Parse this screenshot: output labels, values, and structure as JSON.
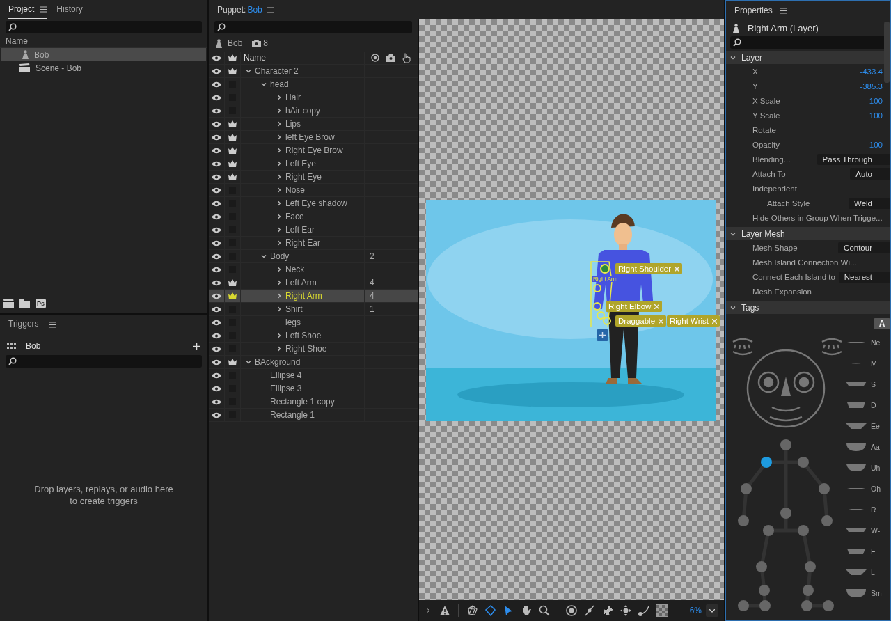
{
  "project_panel": {
    "tabs": [
      {
        "label": "Project",
        "selected": true
      },
      {
        "label": "History",
        "selected": false
      }
    ],
    "column": "Name",
    "items": [
      {
        "kind": "puppet",
        "name": "Bob",
        "selected": true
      },
      {
        "kind": "scene",
        "name": "Scene - Bob",
        "selected": false
      }
    ],
    "footer_badge": "Ps"
  },
  "triggers_panel": {
    "title": "Triggers",
    "puppet": "Bob",
    "empty_message": "Drop layers, replays, or audio here to create triggers"
  },
  "puppet_panel": {
    "title": "Puppet:",
    "puppet_name": "Bob",
    "summary_name": "Bob",
    "behavior_count": "8",
    "column": "Name",
    "layers": [
      {
        "name": "Character 2",
        "crown": true,
        "expanded": true,
        "selected": false,
        "children": [
          {
            "name": "head",
            "crown": false,
            "expanded": true,
            "selected": false,
            "children": [
              {
                "name": "Hair",
                "crown": false,
                "expanded": false,
                "selected": false
              },
              {
                "name": "hAir copy",
                "crown": false,
                "expanded": false,
                "selected": false
              },
              {
                "name": "Lips",
                "crown": true,
                "expanded": false,
                "selected": false
              },
              {
                "name": "left Eye Brow",
                "crown": true,
                "expanded": false,
                "selected": false
              },
              {
                "name": "Right Eye Brow",
                "crown": true,
                "expanded": false,
                "selected": false
              },
              {
                "name": "Left Eye",
                "crown": true,
                "expanded": false,
                "selected": false
              },
              {
                "name": "Right Eye",
                "crown": true,
                "expanded": false,
                "selected": false
              },
              {
                "name": "Nose",
                "crown": false,
                "expanded": false,
                "selected": false
              },
              {
                "name": "Left Eye shadow",
                "crown": false,
                "expanded": false,
                "selected": false
              },
              {
                "name": "Face",
                "crown": false,
                "expanded": false,
                "selected": false
              },
              {
                "name": "Left Ear",
                "crown": false,
                "expanded": false,
                "selected": false
              },
              {
                "name": "Right Ear",
                "crown": false,
                "expanded": false,
                "selected": false
              }
            ]
          },
          {
            "name": "Body",
            "crown": false,
            "expanded": true,
            "selected": false,
            "count": "2",
            "children": [
              {
                "name": "Neck",
                "crown": false,
                "expanded": false,
                "selected": false
              },
              {
                "name": "Left Arm",
                "crown": true,
                "expanded": false,
                "selected": false,
                "count": "4"
              },
              {
                "name": "Right Arm",
                "crown": true,
                "expanded": false,
                "selected": true,
                "count": "4"
              },
              {
                "name": "Shirt",
                "crown": false,
                "expanded": false,
                "selected": false,
                "count": "1"
              },
              {
                "name": "legs",
                "crown": false,
                "selected": false
              },
              {
                "name": "Left Shoe",
                "crown": false,
                "expanded": false,
                "selected": false
              },
              {
                "name": "Right Shoe",
                "crown": false,
                "expanded": false,
                "selected": false
              }
            ]
          }
        ]
      },
      {
        "name": "BAckground",
        "crown": true,
        "expanded": true,
        "selected": false,
        "children": [
          {
            "name": "Ellipse 4",
            "crown": false,
            "selected": false
          },
          {
            "name": "Ellipse 3",
            "crown": false,
            "selected": false
          },
          {
            "name": "Rectangle 1 copy",
            "crown": false,
            "selected": false
          },
          {
            "name": "Rectangle 1",
            "crown": false,
            "selected": false
          }
        ]
      }
    ]
  },
  "canvas": {
    "arm_label": "Right Arm",
    "handles": [
      {
        "label": "Right Shoulder"
      },
      {
        "label": "Right Elbow"
      },
      {
        "label": "Draggable"
      },
      {
        "label": "Right Wrist"
      }
    ],
    "tool_groups": [
      [
        {
          "kind": "expand",
          "selected": false
        },
        {
          "kind": "warning",
          "selected": false
        }
      ],
      [
        {
          "kind": "mesh",
          "selected": false
        },
        {
          "kind": "outline",
          "selected": true
        },
        {
          "kind": "select",
          "selected": true
        },
        {
          "kind": "hand",
          "selected": false
        },
        {
          "kind": "zoom",
          "selected": false
        }
      ],
      [
        {
          "kind": "dragger",
          "selected": false
        },
        {
          "kind": "stick",
          "selected": false
        },
        {
          "kind": "pin",
          "selected": false
        },
        {
          "kind": "move",
          "selected": false
        },
        {
          "kind": "bend",
          "selected": false
        },
        {
          "kind": "checker",
          "selected": false
        }
      ]
    ],
    "zoom": "6%"
  },
  "properties_panel": {
    "title": "Properties",
    "layer_title": "Right Arm (Layer)",
    "sections": [
      {
        "title": "Layer",
        "expanded": true,
        "rows": [
          {
            "kind": "number",
            "label": "X",
            "value": "-433.4"
          },
          {
            "kind": "number",
            "label": "Y",
            "value": "-385.3"
          },
          {
            "kind": "number",
            "label": "X Scale",
            "value": "100"
          },
          {
            "kind": "number",
            "label": "Y Scale",
            "value": "100"
          },
          {
            "kind": "label",
            "label": "Rotate"
          },
          {
            "kind": "number",
            "label": "Opacity",
            "value": "100"
          },
          {
            "kind": "dropdown",
            "label": "Blending...",
            "value": "Pass Through"
          },
          {
            "kind": "dropdown",
            "label": "Attach To",
            "value": "Auto"
          },
          {
            "kind": "label",
            "label": "Independent",
            "children": [
              {
                "kind": "dropdown",
                "label": "Attach Style",
                "value": "Weld"
              }
            ]
          },
          {
            "kind": "label",
            "label": "Hide Others in Group When Trigge..."
          }
        ]
      },
      {
        "title": "Layer Mesh",
        "expanded": true,
        "rows": [
          {
            "kind": "dropdown",
            "label": "Mesh Shape",
            "value": "Contour"
          },
          {
            "kind": "label",
            "label": "Mesh Island Connection Wi..."
          },
          {
            "kind": "dropdown",
            "label": "Connect Each Island to",
            "value": "Nearest"
          },
          {
            "kind": "label",
            "label": "Mesh Expansion"
          }
        ]
      },
      {
        "title": "Tags",
        "expanded": true
      }
    ],
    "tags": {
      "tabs": [
        {
          "label": "A",
          "selected": true
        }
      ],
      "mouths": [
        {
          "label": "Ne"
        },
        {
          "label": "M"
        },
        {
          "label": "S"
        },
        {
          "label": "D"
        },
        {
          "label": "Ee"
        },
        {
          "label": "Aa"
        },
        {
          "label": "Uh"
        },
        {
          "label": "Oh"
        },
        {
          "label": "R"
        },
        {
          "label": "W-"
        },
        {
          "label": "F"
        },
        {
          "label": "L"
        },
        {
          "label": "Sm"
        }
      ],
      "joints": [
        {
          "selected": false
        },
        {
          "selected": true
        },
        {
          "selected": false
        },
        {
          "selected": false
        },
        {
          "selected": false
        },
        {
          "selected": false
        },
        {
          "selected": false
        },
        {
          "selected": false
        },
        {
          "selected": false
        },
        {
          "selected": false
        },
        {
          "selected": false
        },
        {
          "selected": false
        },
        {
          "selected": false
        },
        {
          "selected": false
        },
        {
          "selected": false
        },
        {
          "selected": false
        },
        {
          "selected": false
        },
        {
          "selected": false
        }
      ]
    }
  }
}
